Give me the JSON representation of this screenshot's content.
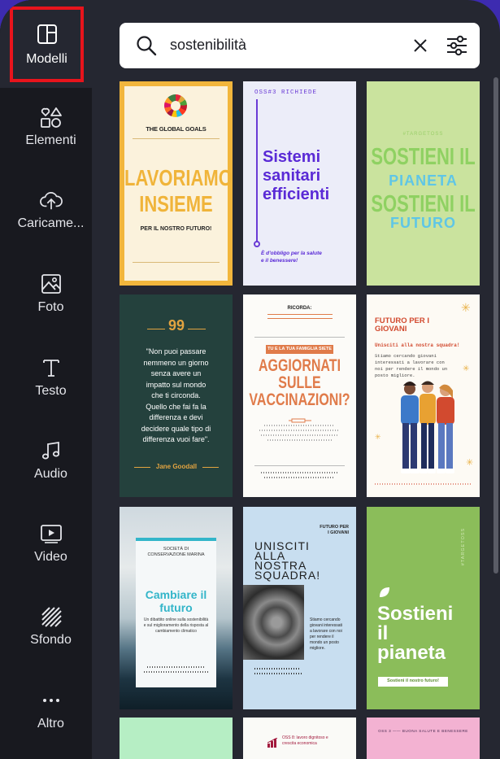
{
  "sidebar": {
    "items": [
      {
        "label": "Modelli",
        "icon": "templates-icon"
      },
      {
        "label": "Elementi",
        "icon": "elements-icon"
      },
      {
        "label": "Caricame...",
        "icon": "upload-cloud-icon"
      },
      {
        "label": "Foto",
        "icon": "photo-icon"
      },
      {
        "label": "Testo",
        "icon": "text-icon"
      },
      {
        "label": "Audio",
        "icon": "music-note-icon"
      },
      {
        "label": "Video",
        "icon": "video-play-icon"
      },
      {
        "label": "Sfondo",
        "icon": "background-pattern-icon"
      },
      {
        "label": "Altro",
        "icon": "more-dots-icon"
      }
    ]
  },
  "search": {
    "value": "sostenibilità"
  },
  "templates": {
    "t1": {
      "logo": "THE GLOBAL GOALS",
      "title1": "LAVORIAMO",
      "title2": "INSIEME",
      "sub": "PER IL NOSTRO FUTURO!"
    },
    "t2": {
      "header": "OSS#3 RICHIEDE",
      "title1": "Sistemi",
      "title2": "sanitari",
      "title3": "efficienti",
      "foot1": "È d'obbligo per la salute",
      "foot2": "e il benessere!"
    },
    "t3": {
      "tag": "#TARGETOSS",
      "l1": "SOSTIENI IL",
      "l2": "PIANETA",
      "l3": "SOSTIENI IL",
      "l4": "FUTURO"
    },
    "t4": {
      "quote_mark": "99",
      "q1": "\"Non puoi passare",
      "q2": "nemmeno un giorno",
      "q3": "senza avere un",
      "q4": "impatto sul mondo",
      "q5": "che ti circonda.",
      "q6": "Quello che fai fa la",
      "q7": "differenza e devi",
      "q8": "decidere quale tipo di",
      "q9": "differenza vuoi fare\".",
      "author": "Jane Goodall"
    },
    "t5": {
      "top": "RICORDA:",
      "band": "TU E LA TUA FAMIGLIA SIETE",
      "l1": "AGGIORNATI",
      "l2": "SULLE",
      "l3": "VACCINAZIONI?"
    },
    "t6": {
      "title1": "FUTURO PER I",
      "title2": "GIOVANI",
      "sub": "Unisciti alla nostra squadra!",
      "body1": "Stiamo cercando giovani",
      "body2": "interessati a lavorare con",
      "body3": "noi per rendere il mondo un",
      "body4": "posto migliore."
    },
    "t7": {
      "org1": "SOCIETÀ DI",
      "org2": "CONSERVAZIONE MARINA",
      "title1": "Cambiare il",
      "title2": "futuro",
      "desc1": "Un dibattito online sulla sostenibilità",
      "desc2": "e sul miglioramento della risposta al",
      "desc3": "cambiamento climatico"
    },
    "t8": {
      "corner1": "FUTURO PER",
      "corner2": "I GIOVANI",
      "l1": "UNISCITI",
      "l2": "ALLA",
      "l3": "NOSTRA",
      "l4": "SQUADRA!",
      "body1": "Stiamo cercando",
      "body2": "giovani interessati",
      "body3": "a lavorare con noi",
      "body4": "per rendere il",
      "body5": "mondo un posto",
      "body6": "migliore."
    },
    "t9": {
      "tag": "#TARGETOSS",
      "l1": "Sostieni",
      "l2": "il",
      "l3": "pianeta",
      "btn": "Sostieni il nostro futuro!"
    },
    "t11": {
      "text1": "OSS 8: lavoro dignitoso e",
      "text2": "crescita economica"
    },
    "t12": {
      "text": "OSS 3 —— BUONA SALUTE E BENESSERE"
    }
  },
  "colors": {
    "accent_red": "#e8141c",
    "sidebar_bg": "#18191f",
    "panel_bg": "#252731"
  }
}
